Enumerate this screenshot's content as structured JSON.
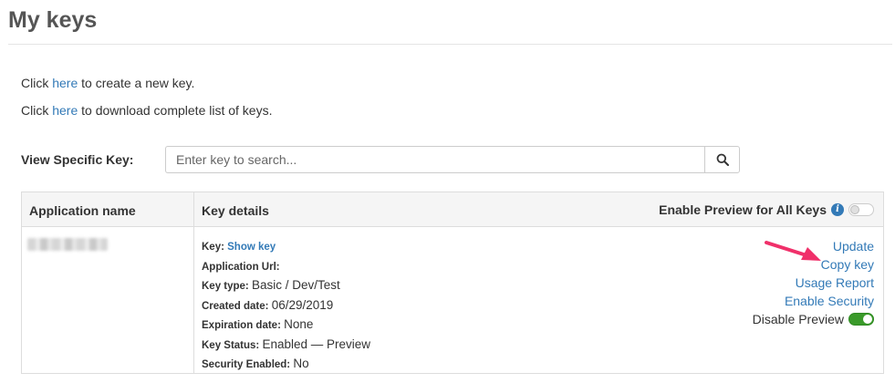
{
  "page": {
    "title": "My keys"
  },
  "intro": {
    "create": {
      "prefix": "Click ",
      "link": "here",
      "suffix": " to create a new key."
    },
    "download": {
      "prefix": "Click ",
      "link": "here",
      "suffix": " to download complete list of keys."
    }
  },
  "search": {
    "label": "View Specific Key:",
    "placeholder": "Enter key to search...",
    "value": "",
    "button_icon": "search-icon"
  },
  "table": {
    "headers": {
      "app_name": "Application name",
      "key_details": "Key details",
      "enable_preview_all": "Enable Preview for All Keys"
    },
    "enable_preview_all_toggle": "off",
    "rows": [
      {
        "app_name": "",
        "details": {
          "key_label": "Key:",
          "key_value": "Show key",
          "app_url_label": "Application Url:",
          "app_url_value": "",
          "key_type_label": "Key type:",
          "key_type_value": "Basic / Dev/Test",
          "created_label": "Created date:",
          "created_value": "06/29/2019",
          "expiration_label": "Expiration date:",
          "expiration_value": "None",
          "status_label": "Key Status:",
          "status_value": "Enabled — Preview",
          "security_label": "Security Enabled:",
          "security_value": "No"
        },
        "actions": {
          "update": "Update",
          "copy_key": "Copy key",
          "usage_report": "Usage Report",
          "enable_security": "Enable Security",
          "disable_preview": "Disable Preview",
          "disable_preview_toggle": "on"
        }
      }
    ]
  },
  "colors": {
    "link": "#337ab7",
    "toggle_on": "#3a9a2a",
    "annotation_arrow": "#f0306a"
  }
}
